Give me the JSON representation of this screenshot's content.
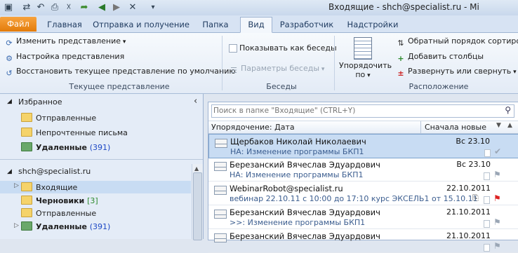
{
  "window": {
    "title": "Входящие - shch@specialist.ru  -  Mi"
  },
  "quick_access": [
    "send-receive-icon",
    "undo-icon",
    "print-icon",
    "delete-icon",
    "reply-icon",
    "back-icon",
    "forward-icon",
    "close-icon"
  ],
  "tabs": [
    {
      "label": "Файл"
    },
    {
      "label": "Главная"
    },
    {
      "label": "Отправка и получение"
    },
    {
      "label": "Папка"
    },
    {
      "label": "Вид"
    },
    {
      "label": "Разработчик"
    },
    {
      "label": "Надстройки"
    }
  ],
  "ribbon": {
    "current_view": {
      "change_view": "Изменить представление",
      "view_settings": "Настройка представления",
      "reset_view": "Восстановить текущее представление по умолчанию",
      "label": "Текущее представление"
    },
    "conversations": {
      "show_as_conversations": "Показывать как беседы",
      "conversation_settings": "Параметры беседы",
      "label": "Беседы"
    },
    "arrangement": {
      "arrange_by_line1": "Упорядочить",
      "arrange_by_line2": "по",
      "reverse_sort": "Обратный порядок сортиров",
      "add_columns": "Добавить столбцы",
      "expand_collapse": "Развернуть или свернуть",
      "label": "Расположение"
    }
  },
  "nav": {
    "favorites_header": "Избранное",
    "favorites": [
      {
        "label": "Отправленные",
        "count": ""
      },
      {
        "label": "Непрочтенные письма",
        "count": ""
      },
      {
        "label": "Удаленные",
        "count": "(391)"
      }
    ],
    "account": "shch@specialist.ru",
    "folders": [
      {
        "label": "Входящие",
        "count": ""
      },
      {
        "label": "Черновики",
        "count": "[3]"
      },
      {
        "label": "Отправленные",
        "count": ""
      },
      {
        "label": "Удаленные",
        "count": "(391)"
      }
    ]
  },
  "mail_list": {
    "search_placeholder": "Поиск в папке \"Входящие\" (CTRL+Y)",
    "sort_label": "Упорядочение: Дата",
    "order_label": "Сначала новые",
    "messages": [
      {
        "sender": "Щербаков Николай Николаевич",
        "subject": "НА: Изменение программы БКП1",
        "date": "Вс 23.10",
        "selected": true
      },
      {
        "sender": "Березанский Вячеслав Эдуардович",
        "subject": "НА: Изменение программы БКП1",
        "date": "Вс 23.10",
        "selected": false
      },
      {
        "sender": "WebinarRobot@specialist.ru",
        "subject": "вебинар 22.10.11 с 10:00 до 17:10  курс ЭКСЕЛЬ1 от 15.10.11",
        "date": "22.10.2011",
        "selected": false
      },
      {
        "sender": "Березанский Вячеслав Эдуардович",
        "subject": ">>: Изменение программы БКП1",
        "date": "21.10.2011",
        "selected": false
      },
      {
        "sender": "Березанский Вячеслав Эдуардович",
        "subject": "",
        "date": "21.10.2011",
        "selected": false
      }
    ]
  }
}
